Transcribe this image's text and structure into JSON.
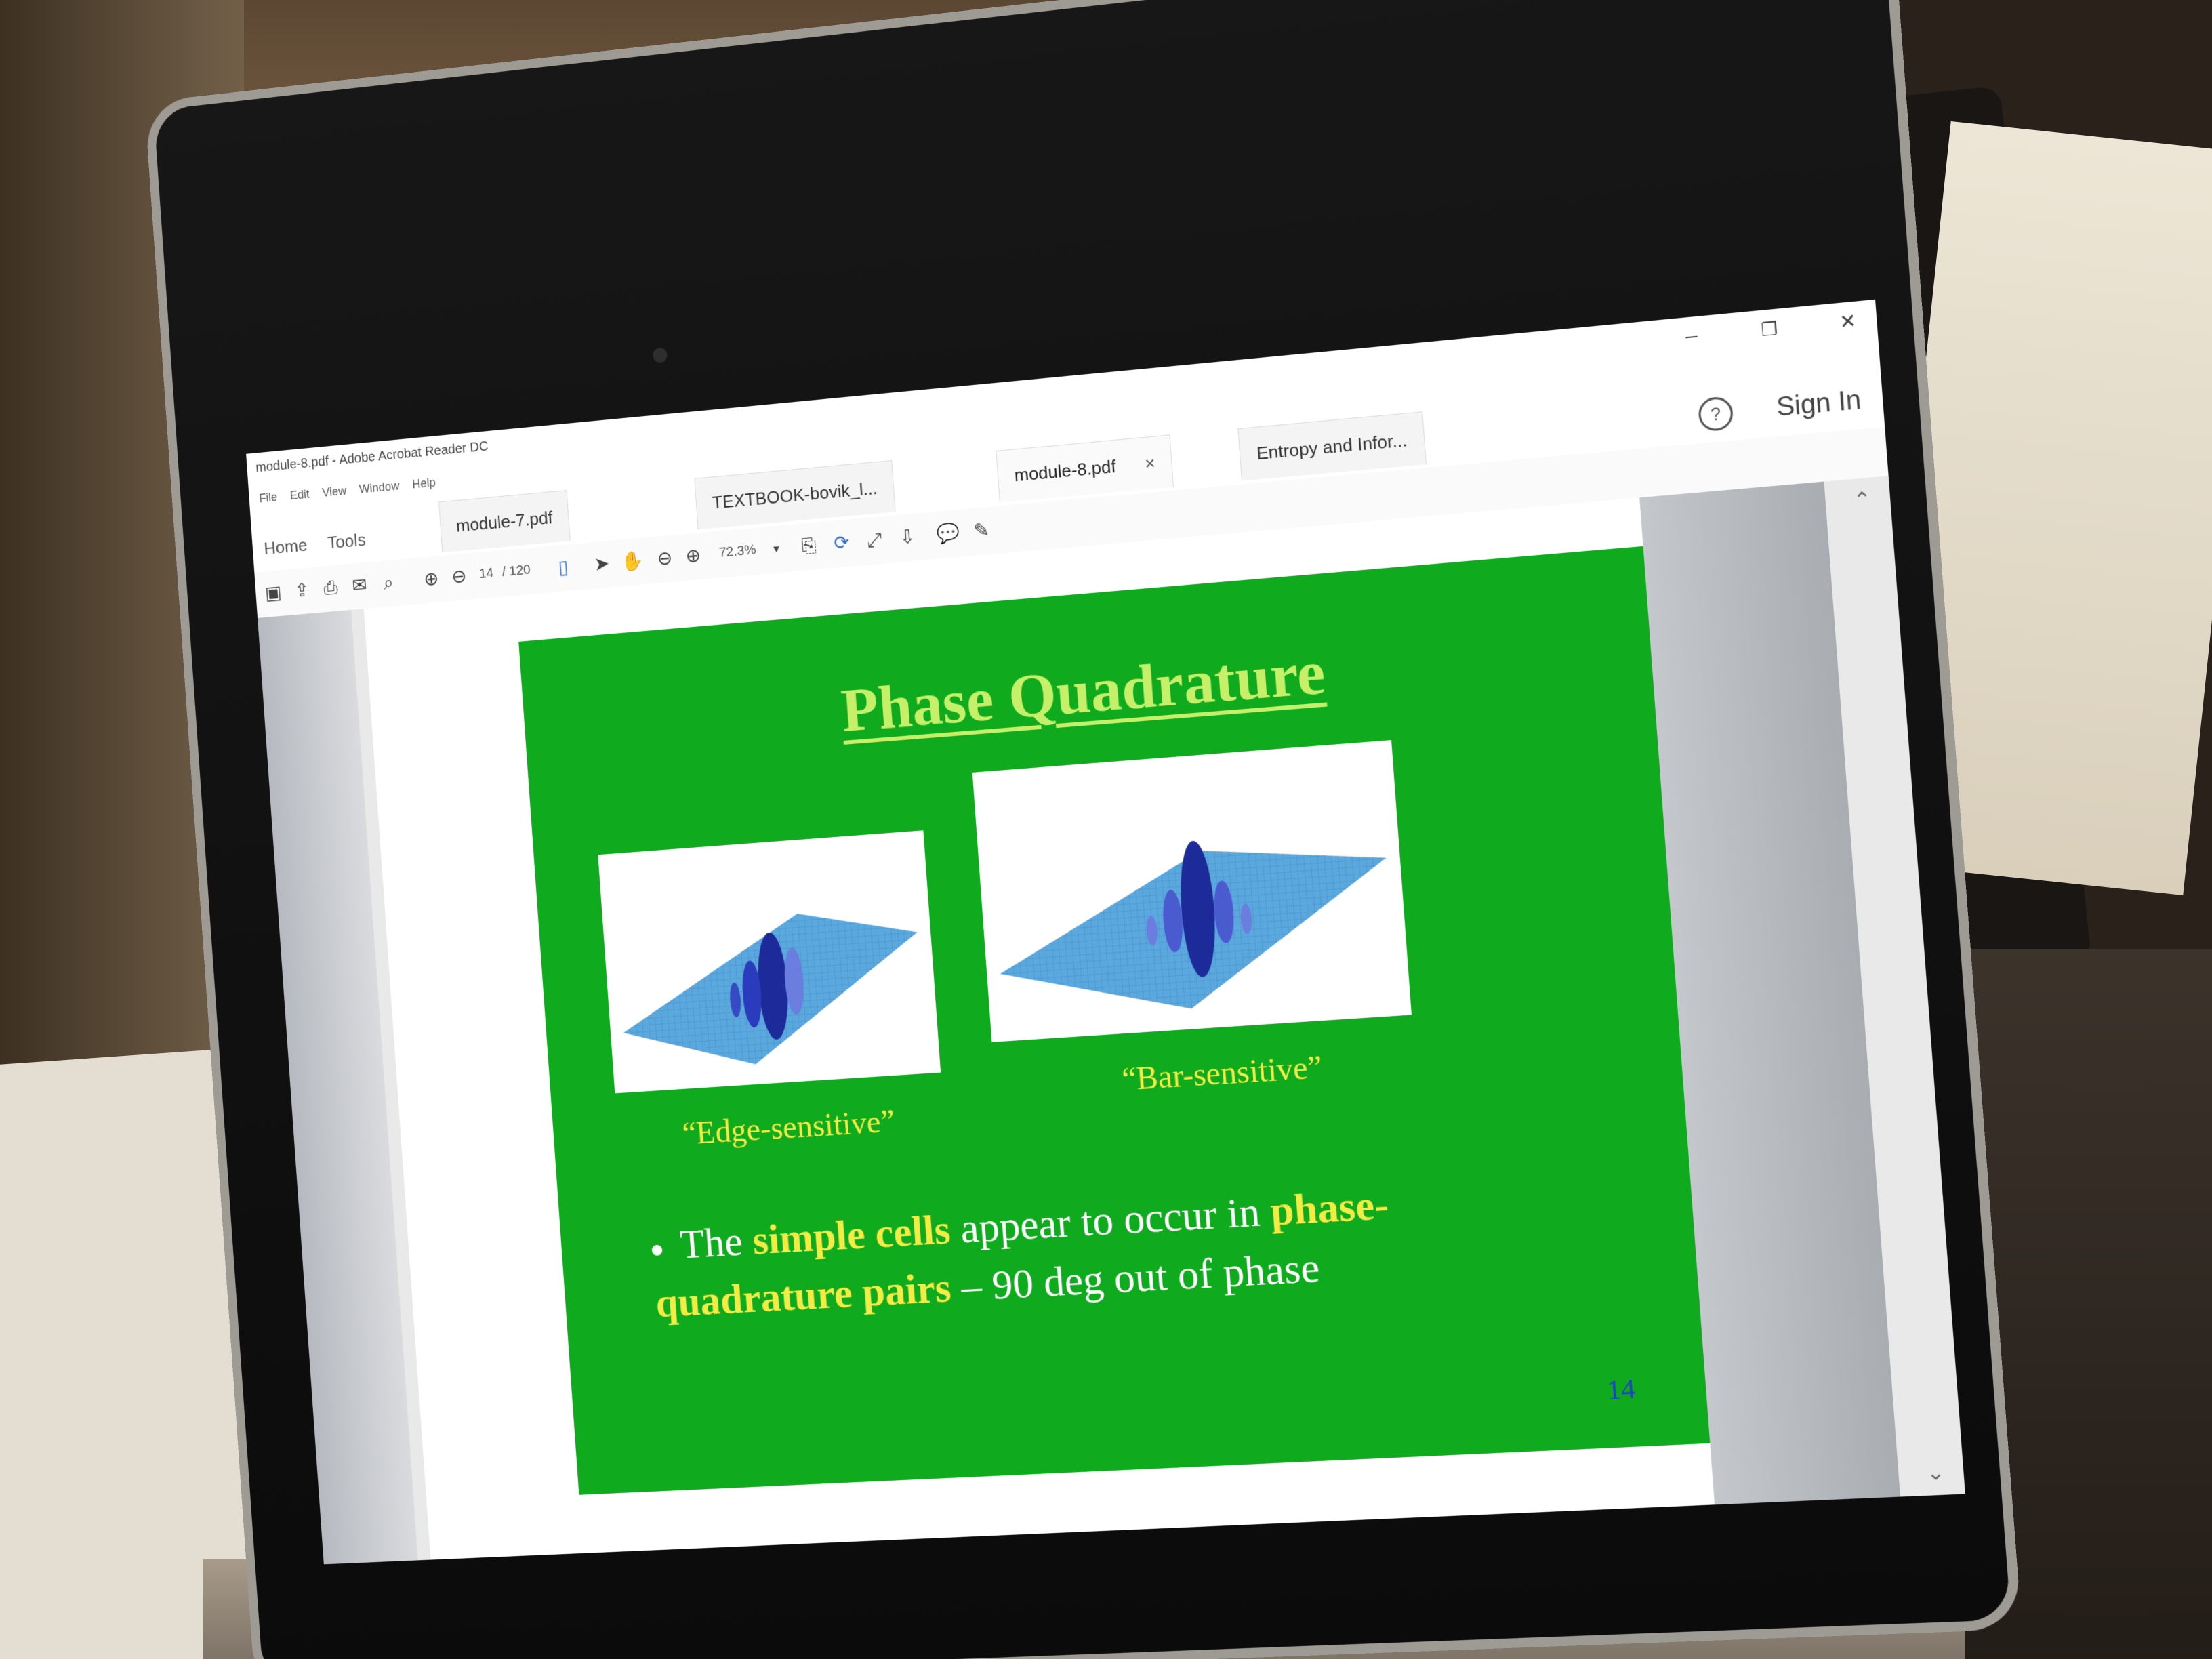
{
  "window": {
    "app_title": "module-8.pdf - Adobe Acrobat Reader DC",
    "minimize_glyph": "–",
    "restore_glyph": "❐",
    "close_glyph": "✕"
  },
  "menu": [
    "File",
    "Edit",
    "View",
    "Window",
    "Help"
  ],
  "nav": {
    "home": "Home",
    "tools": "Tools",
    "sign_in": "Sign In",
    "help_glyph": "?"
  },
  "tabs": [
    {
      "label": "module-7.pdf"
    },
    {
      "label": "TEXTBOOK-bovik_l..."
    },
    {
      "label": "module-8.pdf",
      "close": "×"
    },
    {
      "label": "Entropy and Infor..."
    }
  ],
  "toolbar": {
    "page_current": "14",
    "page_total": "/ 120",
    "zoom": "72.3%"
  },
  "slide": {
    "title": "Phase Quadrature",
    "caption_left": "“Edge-sensitive”",
    "caption_right": "“Bar-sensitive”",
    "bullet_text_1": "The ",
    "bullet_hl_1": "simple cells",
    "bullet_text_2": " appear to occur in ",
    "bullet_hl_2": "phase-quadrature pairs",
    "bullet_text_3": " – 90 deg out of phase",
    "page_number": "14"
  },
  "colors": {
    "slide_background": "#0faa1e",
    "title": "#c6f06a",
    "highlight": "#f3ec45",
    "page_number": "#1d3fd0"
  },
  "icons": [
    "save-icon",
    "upload-icon",
    "print-icon",
    "mail-icon",
    "search-icon",
    "prev-page-icon",
    "next-page-icon",
    "page-icon",
    "select-arrow-icon",
    "hand-icon",
    "zoom-out-icon",
    "zoom-in-icon",
    "fit-page-icon",
    "rotate-icon",
    "full-screen-icon",
    "download-icon",
    "comment-icon",
    "pen-icon"
  ]
}
